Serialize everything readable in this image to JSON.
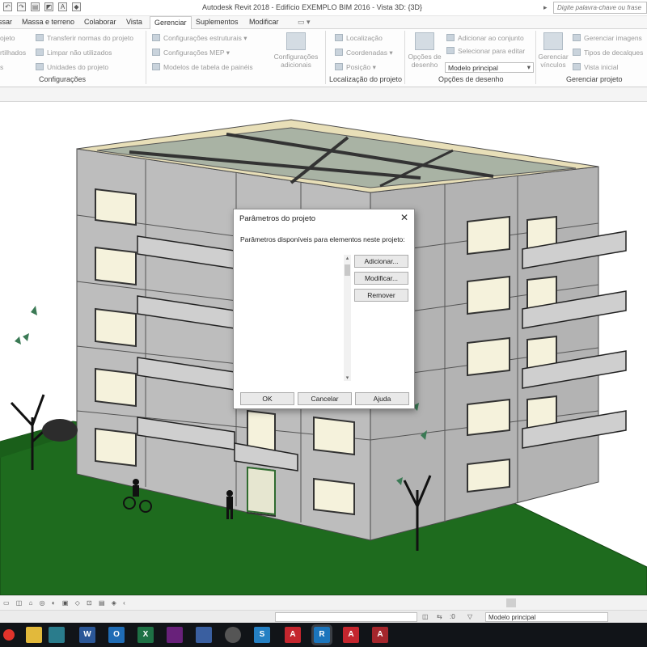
{
  "window": {
    "title": "Autodesk Revit 2018 -   Edifício EXEMPLO BIM 2016 - Vista 3D: {3D}",
    "search_placeholder": "Digite palavra-chave ou frase"
  },
  "tabs": [
    {
      "label": "ssar"
    },
    {
      "label": "Massa e terreno"
    },
    {
      "label": "Colaborar"
    },
    {
      "label": "Vista"
    },
    {
      "label": "Gerenciar",
      "active": true
    },
    {
      "label": "Suplementos"
    },
    {
      "label": "Modificar"
    }
  ],
  "ribbon": {
    "config": {
      "left_items": [
        "ojeto",
        "rtilhados",
        "s"
      ],
      "items": [
        "Transferir normas do projeto",
        "Limpar não utilizados",
        "Unidades do projeto"
      ],
      "label": "Configurações"
    },
    "struct": {
      "items": [
        "Configurações estruturais",
        "Configurações MEP",
        "Modelos de tabela de painéis"
      ],
      "big_button": "Configurações adicionais"
    },
    "location": {
      "items": [
        "Localização",
        "Coordenadas",
        "Posição"
      ],
      "label": "Localização do projeto"
    },
    "design_options": {
      "big_button": "Opções de desenho",
      "items": [
        "Adicionar ao conjunto",
        "Selecionar para editar"
      ],
      "dropdown_value": "Modelo principal",
      "label": "Opções de desenho"
    },
    "manage_project": {
      "big_button": "Gerenciar vínculos",
      "items": [
        "Gerenciar imagens",
        "Tipos de decalques",
        "Vista inicial"
      ],
      "label": "Gerenciar projeto"
    }
  },
  "dialog": {
    "title": "Parâmetros do projeto",
    "close_glyph": "✕",
    "description": "Parâmetros disponíveis para elementos neste projeto:",
    "buttons": {
      "add": "Adicionar...",
      "modify": "Modificar...",
      "remove": "Remover",
      "ok": "OK",
      "cancel": "Cancelar",
      "help": "Ajuda"
    }
  },
  "statusbar": {
    "model_field": "Modelo principal",
    "counter": ":0"
  },
  "taskbar": {
    "apps": [
      {
        "name": "windows",
        "glyph": "",
        "color": "#e1332b"
      },
      {
        "name": "file-explorer",
        "glyph": "",
        "color": "#e2b93b"
      },
      {
        "name": "app-green",
        "glyph": "",
        "color": "#2a7c8c"
      },
      {
        "name": "word",
        "glyph": "W",
        "color": "#2b5797"
      },
      {
        "name": "outlook",
        "glyph": "O",
        "color": "#1f6cb5"
      },
      {
        "name": "excel",
        "glyph": "X",
        "color": "#1e7145"
      },
      {
        "name": "visual-studio",
        "glyph": "",
        "color": "#68217a"
      },
      {
        "name": "photos",
        "glyph": "",
        "color": "#3a5fa0"
      },
      {
        "name": "gallery",
        "glyph": "",
        "color": "#555555"
      },
      {
        "name": "app-s",
        "glyph": "S",
        "color": "#2580c3"
      },
      {
        "name": "autocad",
        "glyph": "A",
        "color": "#c4262e"
      },
      {
        "name": "revit",
        "glyph": "R",
        "color": "#1b75bc"
      },
      {
        "name": "autocad-m",
        "glyph": "A",
        "color": "#c4262e"
      },
      {
        "name": "autocad-g",
        "glyph": "A",
        "color": "#a4262c"
      }
    ]
  },
  "colors": {
    "grass": "#1e6b1e",
    "wall": "#bfbfbf",
    "roof": "#e8dfb8",
    "accent": "#1b75bc"
  }
}
